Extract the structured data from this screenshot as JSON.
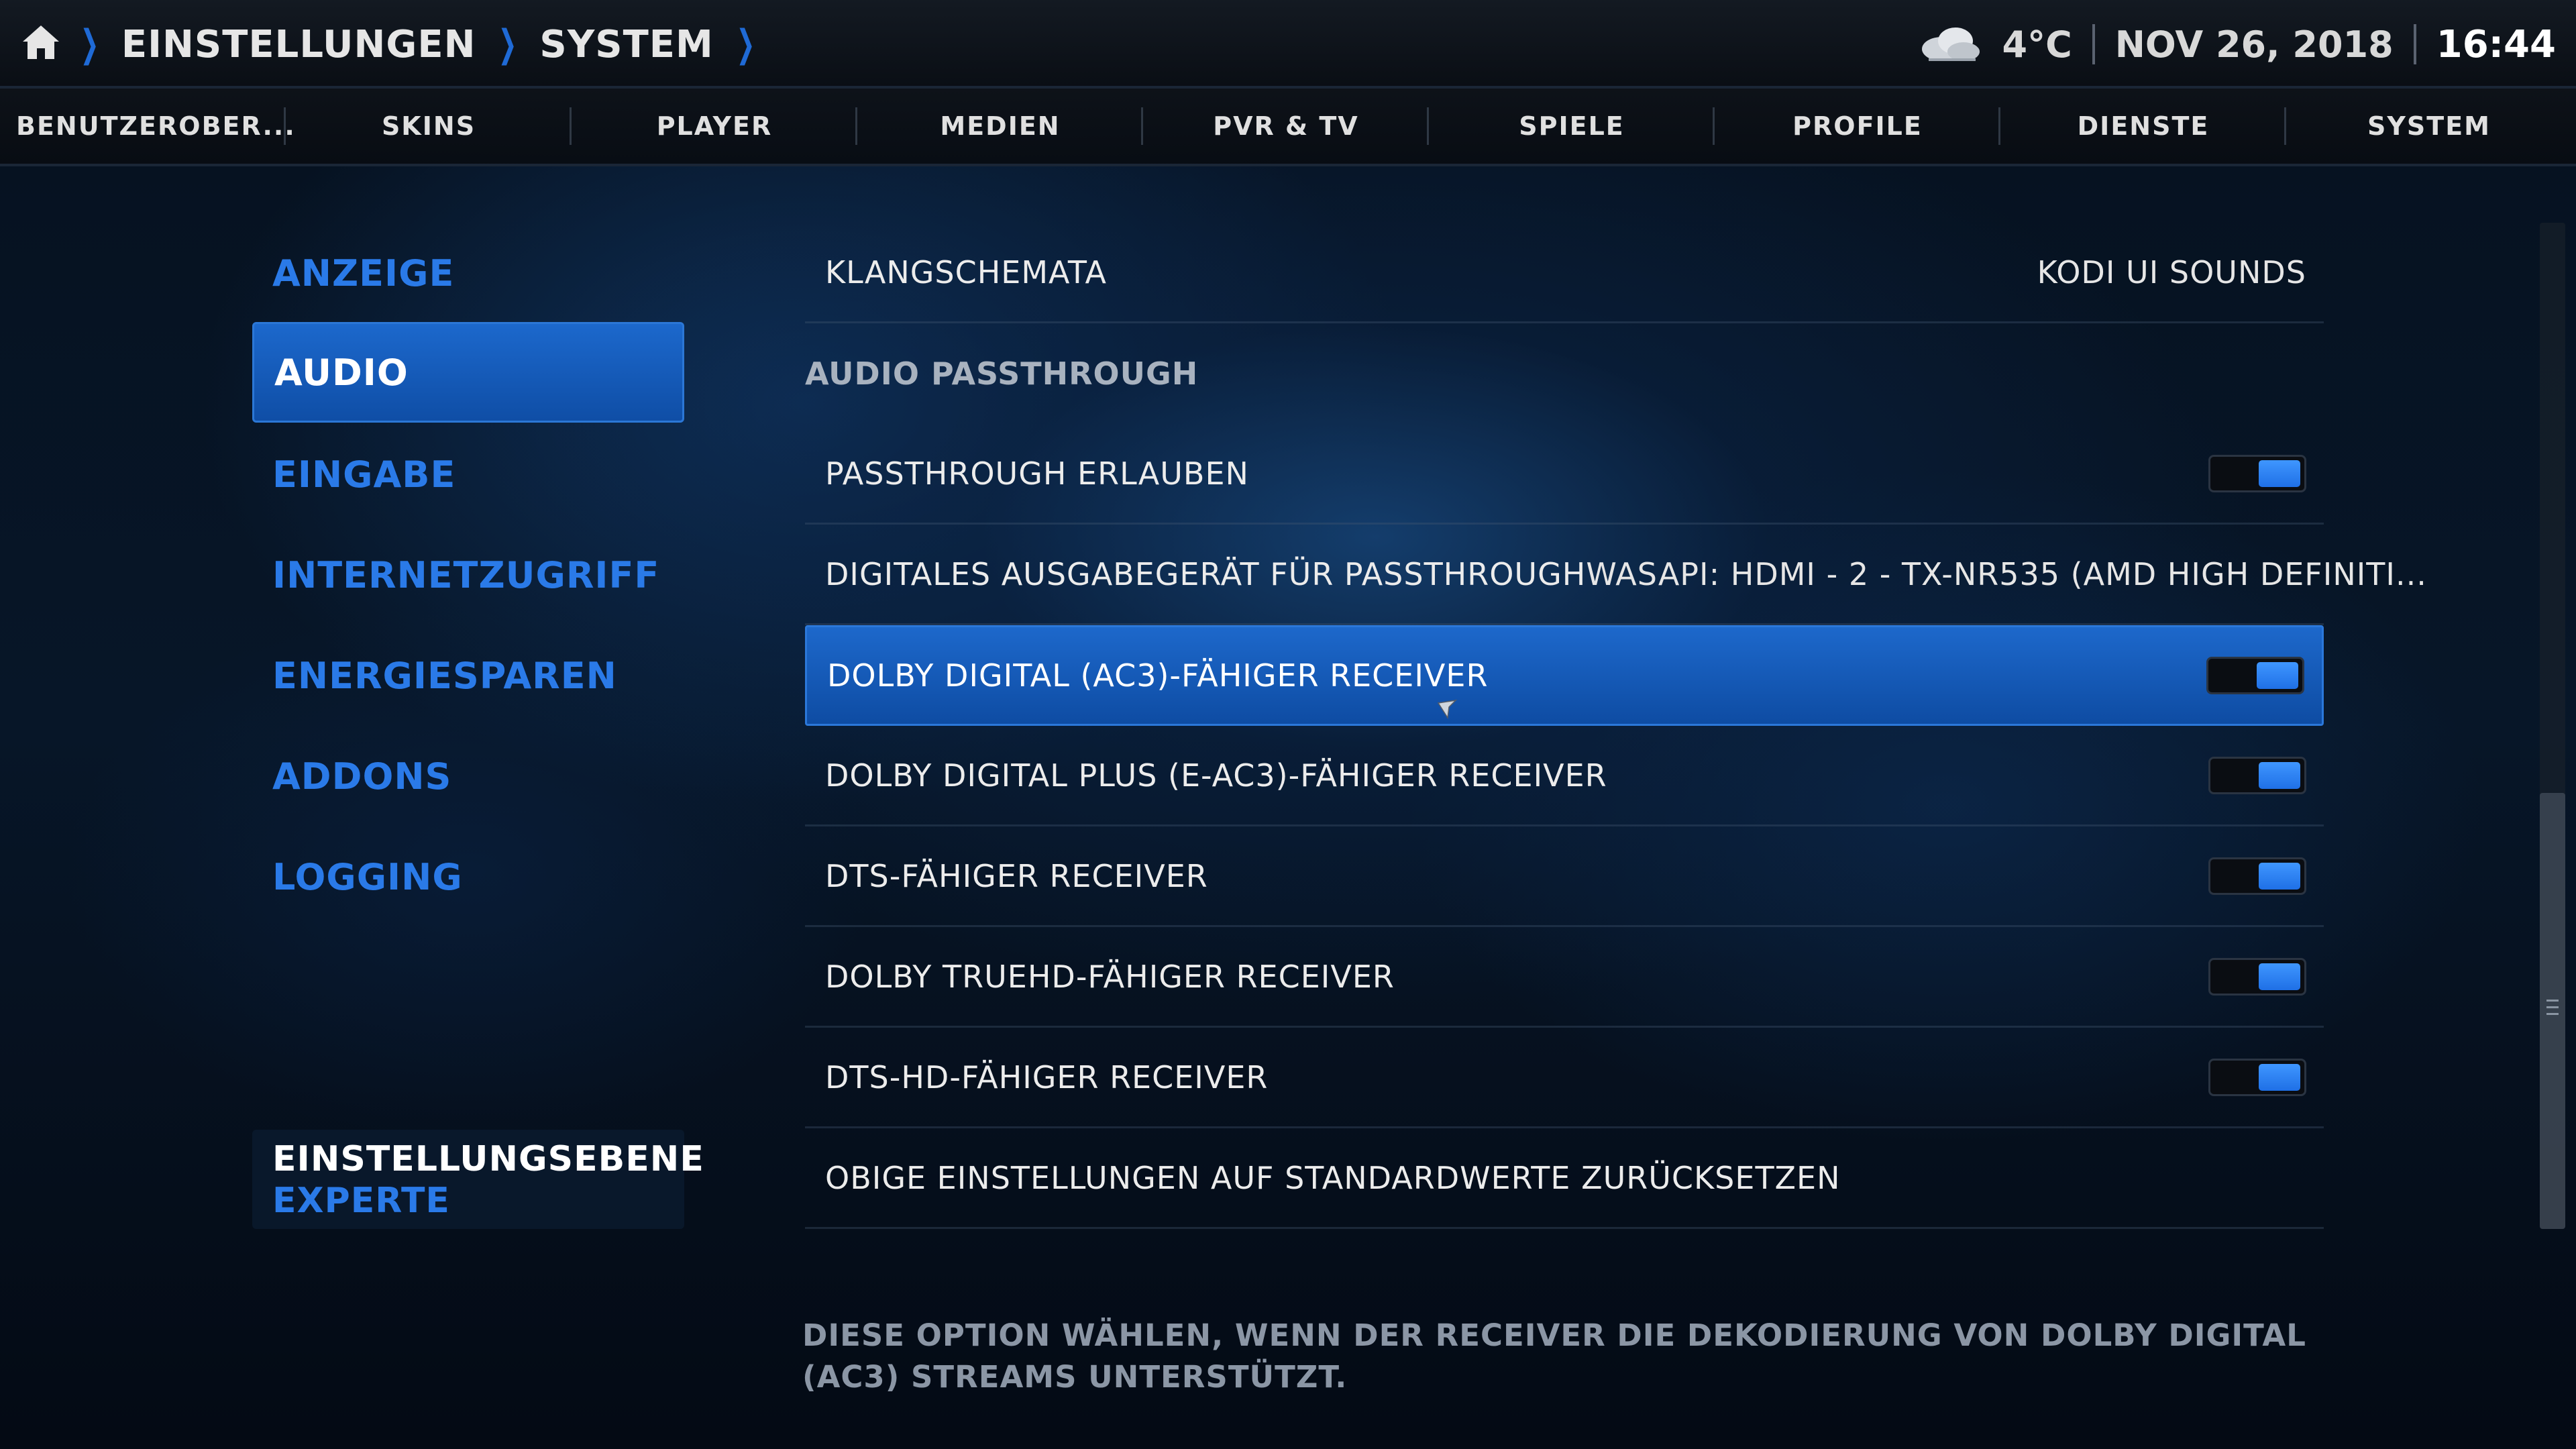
{
  "breadcrumb": {
    "items": [
      "EINSTELLUNGEN",
      "SYSTEM"
    ]
  },
  "status": {
    "temperature": "4°C",
    "date": "NOV 26, 2018",
    "time": "16:44",
    "weather_icon": "cloud-icon"
  },
  "tabs": [
    {
      "label": "BENUTZEROBER..."
    },
    {
      "label": "SKINS"
    },
    {
      "label": "PLAYER"
    },
    {
      "label": "MEDIEN"
    },
    {
      "label": "PVR & TV"
    },
    {
      "label": "SPIELE"
    },
    {
      "label": "PROFILE"
    },
    {
      "label": "DIENSTE"
    },
    {
      "label": "SYSTEM"
    }
  ],
  "menu": {
    "items": [
      {
        "label": "ANZEIGE"
      },
      {
        "label": "AUDIO",
        "active": true
      },
      {
        "label": "EINGABE"
      },
      {
        "label": "INTERNETZUGRIFF"
      },
      {
        "label": "ENERGIESPAREN"
      },
      {
        "label": "ADDONS"
      },
      {
        "label": "LOGGING"
      }
    ],
    "level": {
      "title": "EINSTELLUNGSEBENE",
      "value": "EXPERTE"
    }
  },
  "settings": {
    "rows": [
      {
        "label": "KLANGSCHEMATA",
        "value": "KODI UI SOUNDS"
      },
      {
        "label": "AUDIO PASSTHROUGH",
        "section": true
      },
      {
        "label": "PASSTHROUGH ERLAUBEN",
        "toggle": true
      },
      {
        "label": "DIGITALES AUSGABEGERÄT FÜR PASSTHROUGH",
        "value": "WASAPI: HDMI - 2 - TX-NR535 (AMD HIGH DEFINITI..."
      },
      {
        "label": "DOLBY DIGITAL (AC3)-FÄHIGER RECEIVER",
        "toggle": true,
        "focused": true
      },
      {
        "label": "DOLBY DIGITAL PLUS (E-AC3)-FÄHIGER RECEIVER",
        "toggle": true
      },
      {
        "label": "DTS-FÄHIGER RECEIVER",
        "toggle": true
      },
      {
        "label": "DOLBY TRUEHD-FÄHIGER RECEIVER",
        "toggle": true
      },
      {
        "label": "DTS-HD-FÄHIGER RECEIVER",
        "toggle": true
      },
      {
        "label": "OBIGE EINSTELLUNGEN AUF STANDARDWERTE ZURÜCKSETZEN"
      }
    ],
    "description": "DIESE OPTION WÄHLEN, WENN DER RECEIVER DIE DEKODIERUNG VON DOLBY DIGITAL (AC3) STREAMS UNTERSTÜTZT."
  },
  "colors": {
    "accent": "#1f6ad6",
    "menu_text": "#2a7ae8",
    "toggle_on": "#3f96ff",
    "focus_bg": "#1d68cb"
  }
}
